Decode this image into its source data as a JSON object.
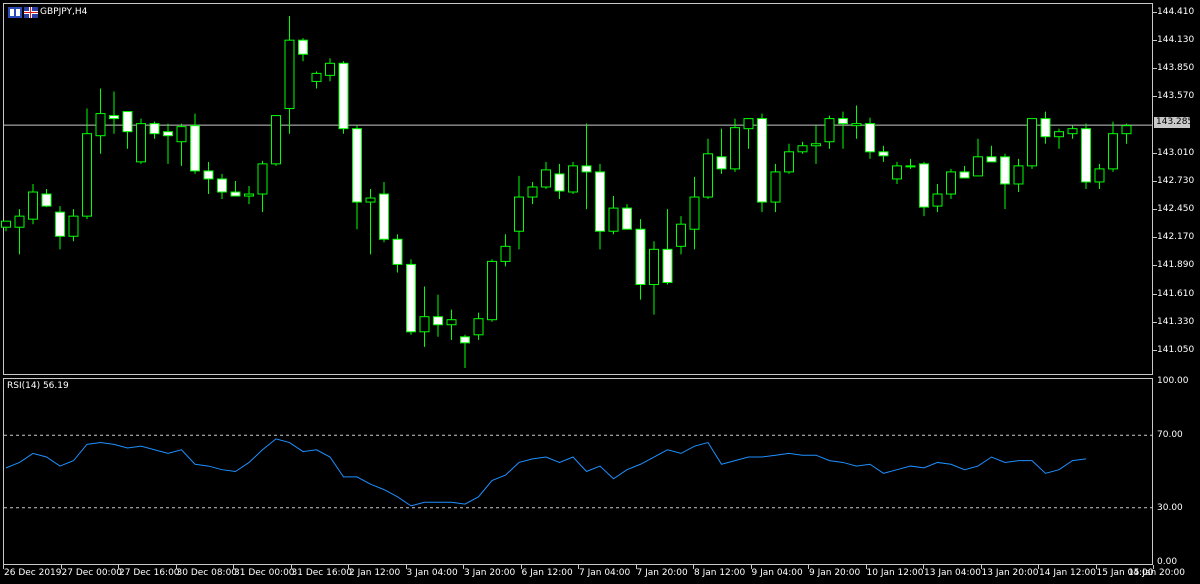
{
  "window": {
    "symbol_title": "GBPJPY,H4",
    "flag_icons": [
      "chart-window-icon-red-white-blue",
      "chart-window-icon-flag"
    ]
  },
  "colors": {
    "background": "#000000",
    "bull_border": "#00ff00",
    "bear_fill": "#ffffff",
    "wick": "#00ff00",
    "rsi_line": "#1e90ff",
    "grid_line": "#c8c8c8"
  },
  "price_axis": {
    "labels": [
      "144.410",
      "144.130",
      "143.850",
      "143.570",
      "143.010",
      "142.730",
      "142.450",
      "142.170",
      "141.890",
      "141.610",
      "141.330",
      "141.050"
    ],
    "current_price": "143.285"
  },
  "time_axis": {
    "labels": [
      "26 Dec 2019",
      "27 Dec 00:00",
      "27 Dec 16:00",
      "30 Dec 08:00",
      "31 Dec 00:00",
      "31 Dec 16:00",
      "2 Jan 12:00",
      "3 Jan 04:00",
      "3 Jan 20:00",
      "6 Jan 12:00",
      "7 Jan 04:00",
      "7 Jan 20:00",
      "8 Jan 12:00",
      "9 Jan 04:00",
      "9 Jan 20:00",
      "10 Jan 12:00",
      "13 Jan 04:00",
      "13 Jan 20:00",
      "14 Jan 12:00",
      "15 Jan 04:00",
      "15 Jan 20:00"
    ]
  },
  "rsi": {
    "title": "RSI(14) 56.19",
    "axis_labels": [
      "100.00",
      "70.00",
      "30.00",
      "0.00"
    ],
    "levels": [
      70,
      30
    ]
  },
  "chart_data": {
    "type": "candlestick",
    "symbol": "GBPJPY",
    "timeframe": "H4",
    "ylim": [
      140.83,
      144.45
    ],
    "candles": [
      {
        "o": 142.27,
        "h": 142.33,
        "l": 142.23,
        "c": 142.33
      },
      {
        "o": 142.27,
        "h": 142.45,
        "l": 142.0,
        "c": 142.38
      },
      {
        "o": 142.35,
        "h": 142.7,
        "l": 142.3,
        "c": 142.62
      },
      {
        "o": 142.6,
        "h": 142.65,
        "l": 142.47,
        "c": 142.48
      },
      {
        "o": 142.42,
        "h": 142.48,
        "l": 142.05,
        "c": 142.18
      },
      {
        "o": 142.18,
        "h": 142.45,
        "l": 142.13,
        "c": 142.38
      },
      {
        "o": 142.38,
        "h": 143.45,
        "l": 142.35,
        "c": 143.2
      },
      {
        "o": 143.18,
        "h": 143.65,
        "l": 143.0,
        "c": 143.4
      },
      {
        "o": 143.38,
        "h": 143.62,
        "l": 143.2,
        "c": 143.35
      },
      {
        "o": 143.42,
        "h": 143.42,
        "l": 143.05,
        "c": 143.22
      },
      {
        "o": 142.92,
        "h": 143.35,
        "l": 142.9,
        "c": 143.3
      },
      {
        "o": 143.3,
        "h": 143.32,
        "l": 143.15,
        "c": 143.2
      },
      {
        "o": 143.22,
        "h": 143.3,
        "l": 142.9,
        "c": 143.18
      },
      {
        "o": 143.12,
        "h": 143.3,
        "l": 142.88,
        "c": 143.27
      },
      {
        "o": 143.28,
        "h": 143.4,
        "l": 142.8,
        "c": 142.83
      },
      {
        "o": 142.83,
        "h": 142.92,
        "l": 142.6,
        "c": 142.75
      },
      {
        "o": 142.75,
        "h": 142.8,
        "l": 142.55,
        "c": 142.62
      },
      {
        "o": 142.62,
        "h": 142.73,
        "l": 142.58,
        "c": 142.58
      },
      {
        "o": 142.58,
        "h": 142.68,
        "l": 142.5,
        "c": 142.6
      },
      {
        "o": 142.6,
        "h": 142.93,
        "l": 142.42,
        "c": 142.9
      },
      {
        "o": 142.9,
        "h": 143.35,
        "l": 142.88,
        "c": 143.38
      },
      {
        "o": 143.45,
        "h": 144.37,
        "l": 143.2,
        "c": 144.13
      },
      {
        "o": 144.13,
        "h": 144.15,
        "l": 143.92,
        "c": 143.99
      },
      {
        "o": 143.72,
        "h": 143.82,
        "l": 143.65,
        "c": 143.8
      },
      {
        "o": 143.78,
        "h": 143.95,
        "l": 143.72,
        "c": 143.9
      },
      {
        "o": 143.9,
        "h": 143.92,
        "l": 143.2,
        "c": 143.25
      },
      {
        "o": 143.25,
        "h": 143.28,
        "l": 142.25,
        "c": 142.52
      },
      {
        "o": 142.52,
        "h": 142.65,
        "l": 142.0,
        "c": 142.56
      },
      {
        "o": 142.6,
        "h": 142.72,
        "l": 142.12,
        "c": 142.15
      },
      {
        "o": 142.15,
        "h": 142.2,
        "l": 141.82,
        "c": 141.9
      },
      {
        "o": 141.9,
        "h": 141.95,
        "l": 141.2,
        "c": 141.23
      },
      {
        "o": 141.23,
        "h": 141.68,
        "l": 141.08,
        "c": 141.38
      },
      {
        "o": 141.38,
        "h": 141.6,
        "l": 141.18,
        "c": 141.3
      },
      {
        "o": 141.3,
        "h": 141.45,
        "l": 141.15,
        "c": 141.35
      },
      {
        "o": 141.18,
        "h": 141.2,
        "l": 140.87,
        "c": 141.12
      },
      {
        "o": 141.2,
        "h": 141.42,
        "l": 141.15,
        "c": 141.36
      },
      {
        "o": 141.35,
        "h": 141.95,
        "l": 141.33,
        "c": 141.93
      },
      {
        "o": 141.93,
        "h": 142.2,
        "l": 141.88,
        "c": 142.08
      },
      {
        "o": 142.23,
        "h": 142.78,
        "l": 142.05,
        "c": 142.57
      },
      {
        "o": 142.57,
        "h": 142.72,
        "l": 142.5,
        "c": 142.67
      },
      {
        "o": 142.67,
        "h": 142.92,
        "l": 142.65,
        "c": 142.84
      },
      {
        "o": 142.8,
        "h": 142.9,
        "l": 142.55,
        "c": 142.63
      },
      {
        "o": 142.62,
        "h": 142.92,
        "l": 142.6,
        "c": 142.88
      },
      {
        "o": 142.88,
        "h": 143.3,
        "l": 142.45,
        "c": 142.82
      },
      {
        "o": 142.82,
        "h": 142.9,
        "l": 142.05,
        "c": 142.23
      },
      {
        "o": 142.23,
        "h": 142.58,
        "l": 142.2,
        "c": 142.46
      },
      {
        "o": 142.46,
        "h": 142.5,
        "l": 142.25,
        "c": 142.25
      },
      {
        "o": 142.25,
        "h": 142.35,
        "l": 141.55,
        "c": 141.7
      },
      {
        "o": 141.7,
        "h": 142.13,
        "l": 141.4,
        "c": 142.05
      },
      {
        "o": 142.05,
        "h": 142.45,
        "l": 141.7,
        "c": 141.72
      },
      {
        "o": 142.08,
        "h": 142.38,
        "l": 142.0,
        "c": 142.3
      },
      {
        "o": 142.25,
        "h": 142.77,
        "l": 142.05,
        "c": 142.57
      },
      {
        "o": 142.57,
        "h": 143.15,
        "l": 142.55,
        "c": 143.0
      },
      {
        "o": 142.97,
        "h": 143.25,
        "l": 142.8,
        "c": 142.85
      },
      {
        "o": 142.85,
        "h": 143.35,
        "l": 142.82,
        "c": 143.26
      },
      {
        "o": 143.25,
        "h": 143.35,
        "l": 143.05,
        "c": 143.35
      },
      {
        "o": 143.35,
        "h": 143.4,
        "l": 142.42,
        "c": 142.52
      },
      {
        "o": 142.52,
        "h": 142.9,
        "l": 142.42,
        "c": 142.82
      },
      {
        "o": 142.82,
        "h": 143.1,
        "l": 142.8,
        "c": 143.02
      },
      {
        "o": 143.02,
        "h": 143.12,
        "l": 143.0,
        "c": 143.08
      },
      {
        "o": 143.08,
        "h": 143.28,
        "l": 142.9,
        "c": 143.1
      },
      {
        "o": 143.12,
        "h": 143.38,
        "l": 143.05,
        "c": 143.35
      },
      {
        "o": 143.35,
        "h": 143.42,
        "l": 143.05,
        "c": 143.3
      },
      {
        "o": 143.28,
        "h": 143.48,
        "l": 143.15,
        "c": 143.3
      },
      {
        "o": 143.3,
        "h": 143.36,
        "l": 142.95,
        "c": 143.02
      },
      {
        "o": 143.02,
        "h": 143.08,
        "l": 142.92,
        "c": 142.98
      },
      {
        "o": 142.75,
        "h": 142.92,
        "l": 142.7,
        "c": 142.88
      },
      {
        "o": 142.88,
        "h": 142.95,
        "l": 142.85,
        "c": 142.87
      },
      {
        "o": 142.9,
        "h": 142.92,
        "l": 142.38,
        "c": 142.47
      },
      {
        "o": 142.48,
        "h": 142.7,
        "l": 142.42,
        "c": 142.6
      },
      {
        "o": 142.6,
        "h": 142.85,
        "l": 142.55,
        "c": 142.82
      },
      {
        "o": 142.82,
        "h": 142.88,
        "l": 142.77,
        "c": 142.76
      },
      {
        "o": 142.78,
        "h": 143.15,
        "l": 142.78,
        "c": 142.97
      },
      {
        "o": 142.97,
        "h": 143.08,
        "l": 142.92,
        "c": 142.92
      },
      {
        "o": 142.97,
        "h": 143.0,
        "l": 142.45,
        "c": 142.7
      },
      {
        "o": 142.7,
        "h": 142.95,
        "l": 142.62,
        "c": 142.88
      },
      {
        "o": 142.88,
        "h": 143.35,
        "l": 142.85,
        "c": 143.35
      },
      {
        "o": 143.35,
        "h": 143.42,
        "l": 143.1,
        "c": 143.17
      },
      {
        "o": 143.17,
        "h": 143.25,
        "l": 143.05,
        "c": 143.22
      },
      {
        "o": 143.2,
        "h": 143.28,
        "l": 143.15,
        "c": 143.25
      },
      {
        "o": 143.25,
        "h": 143.3,
        "l": 142.65,
        "c": 142.72
      },
      {
        "o": 142.72,
        "h": 142.9,
        "l": 142.65,
        "c": 142.85
      },
      {
        "o": 142.85,
        "h": 143.32,
        "l": 142.82,
        "c": 143.2
      },
      {
        "o": 143.2,
        "h": 143.3,
        "l": 143.1,
        "c": 143.28
      }
    ],
    "rsi": {
      "period": 14,
      "ylim": [
        0,
        100
      ],
      "values": [
        52,
        55,
        60,
        58,
        53,
        56,
        65,
        66,
        65,
        63,
        64,
        62,
        60,
        62,
        54,
        53,
        51,
        50,
        55,
        62,
        68,
        66,
        61,
        62,
        58,
        47,
        47,
        43,
        40,
        36,
        31,
        33,
        33,
        33,
        32,
        36,
        45,
        48,
        55,
        57,
        58,
        55,
        58,
        50,
        53,
        46,
        51,
        54,
        58,
        62,
        60,
        64,
        66,
        54,
        56,
        58,
        58,
        59,
        60,
        59,
        59,
        56,
        55,
        53,
        54,
        49,
        51,
        53,
        52,
        55,
        54,
        51,
        53,
        58,
        55,
        56,
        56,
        49,
        51,
        56,
        57
      ],
      "last_value": 56.19,
      "levels": [
        70,
        30
      ]
    },
    "grid": false
  }
}
